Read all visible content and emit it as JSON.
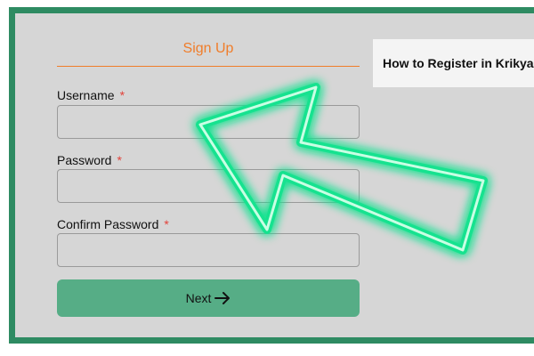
{
  "form": {
    "heading": "Sign Up",
    "fields": [
      {
        "label": "Username",
        "required_mark": "*",
        "value": ""
      },
      {
        "label": "Password",
        "required_mark": "*",
        "value": ""
      },
      {
        "label": "Confirm Password",
        "required_mark": "*",
        "value": ""
      }
    ],
    "next_label": "Next"
  },
  "info_card": {
    "title": "How to Register in Krikya"
  },
  "overlay": {
    "icon": "pointer-arrow-icon",
    "glow_color": "#19e28f"
  },
  "colors": {
    "frame": "#2e8b62",
    "heading": "#f07d2a",
    "required": "#e2423a",
    "button": "#56ad86",
    "panel": "#d6d6d6"
  }
}
